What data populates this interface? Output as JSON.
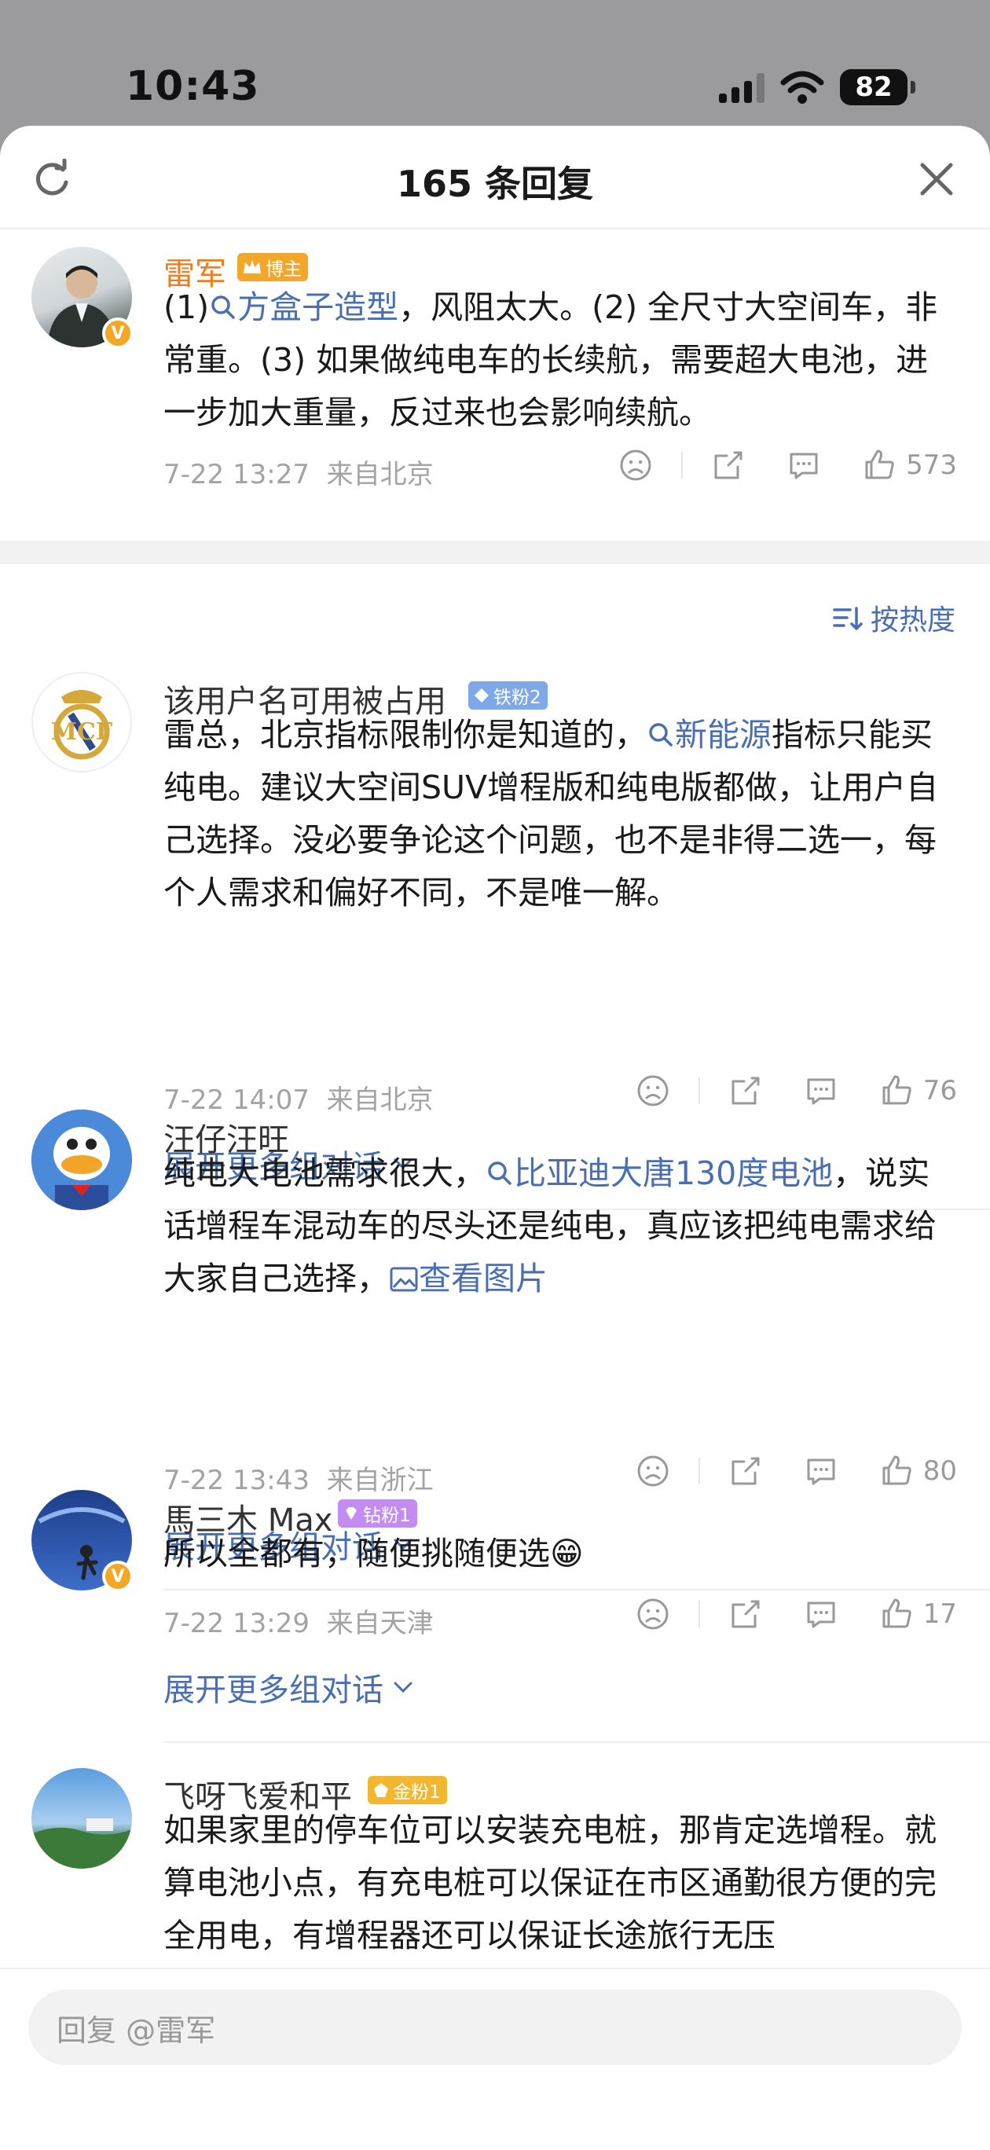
{
  "status": {
    "time": "10:43",
    "battery": "82"
  },
  "header": {
    "title": "165 条回复"
  },
  "top_comment": {
    "user": "雷军",
    "tag": "博主",
    "text_pre": "(1)",
    "link": "方盒子造型",
    "text_post": "，风阻太大。(2) 全尺寸大空间车，非常重。(3) 如果做纯电车的长续航，需要超大电池，进一步加大重量，反过来也会影响续航。",
    "time": "7-22 13:27",
    "location": "来自北京",
    "likes": "573"
  },
  "sort_label": "按热度",
  "comments": [
    {
      "user": "该用户名可用被占用",
      "badge": "铁粉2",
      "badge_color": "#7fa8e8",
      "text_a": "雷总，北京指标限制你是知道的，",
      "link": "新能源",
      "text_b": "指标只能买纯电。建议大空间SUV增程版和纯电版都做，让用户自己选择。没必要争论这个问题，也不是非得二选一，每个人需求和偏好不同，不是唯一解。",
      "time": "7-22 14:07",
      "location": "来自北京",
      "likes": "76",
      "expand": "展开更多组对话"
    },
    {
      "user": "汪仔汪旺",
      "text_a": "纯电大电池需求很大，",
      "link": "比亚迪大唐130度电池",
      "text_b": "，说实话增程车混动车的尽头还是纯电，真应该把纯电需求给大家自己选择，",
      "image_link": "查看图片",
      "time": "7-22 13:43",
      "location": "来自浙江",
      "likes": "80",
      "expand": "展开更多组对话"
    },
    {
      "user": "馬三木 Max",
      "badge": "钻粉1",
      "badge_color": "#c38cf0",
      "text_a": "所以全都有，随便挑随便选",
      "emoji": "😁",
      "time": "7-22 13:29",
      "location": "来自天津",
      "likes": "17",
      "expand": "展开更多组对话"
    },
    {
      "user": "飞呀飞爱和平",
      "badge": "金粉1",
      "badge_color": "#f3b72f",
      "text_a": "如果家里的停车位可以安装充电桩，那肯定选增程。就算电池小点，有充电桩可以保证在市区通勤很方便的完全用电，有增程器还可以保证长途旅行无压"
    }
  ],
  "reply_placeholder": "回复 @雷军",
  "colors": {
    "link": "#4a6fb0",
    "author": "#f07c1d",
    "meta": "#a3a3a3"
  }
}
